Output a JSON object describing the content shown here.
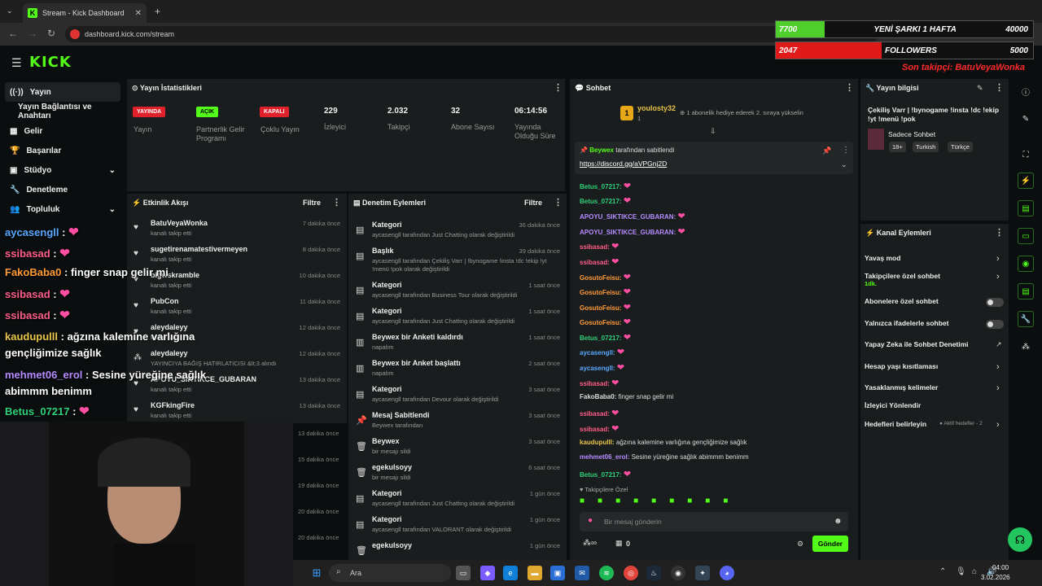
{
  "browser": {
    "tab_title": "Stream - Kick Dashboard",
    "url": "dashboard.kick.com/stream"
  },
  "logo": "KICK",
  "overlay": {
    "bar1": {
      "left": "7700",
      "title": "YENİ ŞARKI 1 HAFTA",
      "right": "40000",
      "color": "#4fcf2c"
    },
    "bar2": {
      "left": "2047",
      "title": "FOLLOWERS",
      "right": "5000",
      "color": "#e01919"
    },
    "newest_follower": "Son takipçi: BatuVeyaWonka"
  },
  "sidebar": {
    "items": [
      {
        "label": "Yayın",
        "icon": "broadcast-icon"
      },
      {
        "label": "Yayın Bağlantısı ve Anahtarı",
        "icon": ""
      },
      {
        "label": "Gelir",
        "icon": "revenue-icon"
      },
      {
        "label": "Başarılar",
        "icon": "trophy-icon"
      },
      {
        "label": "Stüdyo",
        "icon": "studio-icon"
      },
      {
        "label": "Denetleme",
        "icon": "wrench-icon"
      },
      {
        "label": "Topluluk",
        "icon": "community-icon"
      }
    ]
  },
  "stats": {
    "title": "Yayın İstatistikleri",
    "items": [
      {
        "badge": "YAYINDA",
        "label": "Yayın"
      },
      {
        "badge": "AÇIK",
        "label": "Partnerlik Gelir Programı"
      },
      {
        "badge": "KAPALI",
        "label": "Çoklu Yayın"
      },
      {
        "value": "229",
        "label": "İzleyici"
      },
      {
        "value": "2.032",
        "label": "Takipçi"
      },
      {
        "value": "32",
        "label": "Abone Sayısı"
      },
      {
        "value": "06:14:56",
        "label": "Yayında Olduğu Süre"
      }
    ]
  },
  "activity": {
    "title": "Etkinlik Akışı",
    "filter": "Filtre",
    "rows": [
      {
        "name": "BatuVeyaWonka",
        "sub": "kanalı takip etti",
        "time": "7 dakika önce"
      },
      {
        "name": "sugetirenamatestivermeyen",
        "sub": "kanalı takip etti",
        "time": "8 dakika önce"
      },
      {
        "name": "bigwskramble",
        "sub": "kanalı takip etti",
        "time": "10 dakika önce"
      },
      {
        "name": "PubCon",
        "sub": "kanalı takip etti",
        "time": "11 dakika önce"
      },
      {
        "name": "aleydaleyy",
        "sub": "kanalı takip etti",
        "time": "12 dakika önce"
      },
      {
        "name": "aleydaleyy",
        "sub": "YAYINCIYA BAĞIŞ HATIRLATICISI &lt;3 alındı",
        "time": "12 dakika önce"
      },
      {
        "name": "APOYU_SIKTIKCE_GUBARAN",
        "sub": "kanalı takip etti",
        "time": "13 dakika önce"
      },
      {
        "name": "KGFkingFire",
        "sub": "kanalı takip etti",
        "time": "13 dakika önce"
      }
    ],
    "extra_times": [
      "13 dakika önce",
      "15 dakika önce",
      "19 dakika önce",
      "20 dakika önce",
      "20 dakika önce"
    ]
  },
  "moderation": {
    "title": "Denetim Eylemleri",
    "filter": "Filtre",
    "rows": [
      {
        "name": "Kategori",
        "sub": "aycasengll tarafından Just Chatting olarak değiştirildi",
        "time": "36 dakika önce"
      },
      {
        "name": "Başlık",
        "sub": "aycasengll tarafından Çekiliş Varr | !bynogame !insta !dc !ekip !yt !menü !pok olarak değiştirildi",
        "time": "39 dakika önce"
      },
      {
        "name": "Kategori",
        "sub": "aycasengll tarafından Business Tour olarak değiştirildi",
        "time": "1 saat önce"
      },
      {
        "name": "Kategori",
        "sub": "aycasengll tarafından Just Chatting olarak değiştirildi",
        "time": "1 saat önce"
      },
      {
        "name": "Beywex bir Anketi kaldırdı",
        "sub": "napalım",
        "time": "1 saat önce"
      },
      {
        "name": "Beywex bir Anket başlattı",
        "sub": "napalım",
        "time": "2 saat önce"
      },
      {
        "name": "Kategori",
        "sub": "aycasengll tarafından Devour olarak değiştirildi",
        "time": "3 saat önce"
      },
      {
        "name": "Mesaj Sabitlendi",
        "sub": "Beywex tarafından",
        "time": "3 saat önce"
      },
      {
        "name": "Beywex",
        "sub": "bir mesajı sildi",
        "time": "3 saat önce"
      },
      {
        "name": "egekulsoyy",
        "sub": "bir mesajı sildi",
        "time": "6 saat önce"
      },
      {
        "name": "Kategori",
        "sub": "aycasengll tarafından Just Chatting olarak değiştirildi",
        "time": "1 gün önce"
      },
      {
        "name": "Kategori",
        "sub": "aycasengll tarafından VALORANT olarak değiştirildi",
        "time": "1 gün önce"
      },
      {
        "name": "egekulsoyy",
        "sub": "",
        "time": "1 gün önce"
      }
    ]
  },
  "chat": {
    "title": "Sohbet",
    "gift_user": "youlosty32",
    "gift_count": "1",
    "gift_text": "1 abonelik hediye ederek 2. sıraya yükselin",
    "pinned_by": "Beywex",
    "pinned_suffix": "tarafından sabitlendi",
    "pinned_link": "https://discord.gg/aVPGnj2D",
    "messages": [
      {
        "user": "Betus_07217:",
        "text": "",
        "color": "#2fd07a"
      },
      {
        "user": "Betus_07217:",
        "text": "",
        "color": "#2fd07a"
      },
      {
        "user": "APOYU_SIKTIKCE_GUBARAN:",
        "text": "",
        "color": "#b58cff"
      },
      {
        "user": "APOYU_SIKTIKCE_GUBARAN:",
        "text": "",
        "color": "#b58cff"
      },
      {
        "user": "ssibasad:",
        "text": "",
        "color": "#ff5e8a"
      },
      {
        "user": "ssibasad:",
        "text": "",
        "color": "#ff5e8a"
      },
      {
        "user": "GosutoFeisu:",
        "text": "",
        "color": "#ff9b3a"
      },
      {
        "user": "GosutoFeisu:",
        "text": "",
        "color": "#ff9b3a"
      },
      {
        "user": "GosutoFeisu:",
        "text": "",
        "color": "#ff9b3a"
      },
      {
        "user": "GosutoFeisu:",
        "text": "",
        "color": "#ff9b3a"
      },
      {
        "user": "Betus_07217:",
        "text": "",
        "color": "#2fd07a"
      },
      {
        "user": "aycasengll:",
        "text": "",
        "color": "#5aa8ff"
      },
      {
        "user": "aycasengll:",
        "text": "",
        "color": "#5aa8ff"
      },
      {
        "user": "ssibasad:",
        "text": "",
        "color": "#ff5e8a"
      },
      {
        "user": "FakoBaba0:",
        "text": "finger snap gelir mi",
        "color": "#dddddd"
      },
      {
        "user": "ssibasad:",
        "text": "",
        "color": "#ff5e8a"
      },
      {
        "user": "ssibasad:",
        "text": "",
        "color": "#ff5e8a"
      },
      {
        "user": "kaudupulll:",
        "text": "ağzına kalemine varlığına gençliğimize sağlık",
        "color": "#e8c64a"
      },
      {
        "user": "mehmet06_erol:",
        "text": "Sesine yüreğine sağlık abimmm benimm",
        "color": "#b58cff"
      },
      {
        "user": "Betus_07217:",
        "text": "",
        "color": "#2fd07a"
      }
    ],
    "followers_only": "Takipçilere Özel",
    "input_placeholder": "Bir mesaj gönderin",
    "points": "0",
    "send": "Gönder"
  },
  "overlay_chat": [
    {
      "user": "aycasengll",
      "text": ""
    },
    {
      "user": "ssibasad",
      "text": ""
    },
    {
      "user": "FakoBaba0",
      "text": "finger snap gelir mi"
    },
    {
      "user": "ssibasad",
      "text": ""
    },
    {
      "user": "ssibasad",
      "text": ""
    },
    {
      "user": "kaudupulll",
      "text": "ağzına kalemine varlığına gençliğimize sağlık"
    },
    {
      "user": "mehmet06_erol",
      "text": "Sesine yüreğine sağlık abimmm benimm"
    },
    {
      "user": "Betus_07217",
      "text": ""
    }
  ],
  "stream_info": {
    "title": "Yayın bilgisi",
    "stream_title": "Çekiliş Varr | !bynogame !insta !dc !ekip !yt !menü !pok",
    "category": "Sadece Sohbet",
    "tags": [
      "18+",
      "Turkish",
      "Türkçe"
    ]
  },
  "channel_actions": {
    "title": "Kanal Eylemleri",
    "rows": [
      {
        "label": "Yavaş mod",
        "type": "chevron"
      },
      {
        "label": "Takipçilere özel sohbet",
        "sub": "1dk.",
        "type": "chevron"
      },
      {
        "label": "Abonelere özel sohbet",
        "type": "toggle"
      },
      {
        "label": "Yalnızca ifadelerle sohbet",
        "type": "toggle"
      },
      {
        "label": "Yapay Zeka ile Sohbet Denetimi",
        "type": "ext"
      },
      {
        "label": "Hesap yaşı kısıtlaması",
        "type": "chevron"
      },
      {
        "label": "Yasaklanmış kelimeler",
        "type": "chevron"
      },
      {
        "label": "İzleyici Yönlendir",
        "type": "none"
      },
      {
        "label": "Hedefleri belirleyin",
        "extra": "Aktif hedefler - 2",
        "type": "chevron"
      }
    ]
  },
  "taskbar": {
    "search": "Ara",
    "time": "04:00",
    "date": "3.02.2026"
  },
  "colors": {
    "kick_green": "#53fc18",
    "live_red": "#e0202a"
  }
}
